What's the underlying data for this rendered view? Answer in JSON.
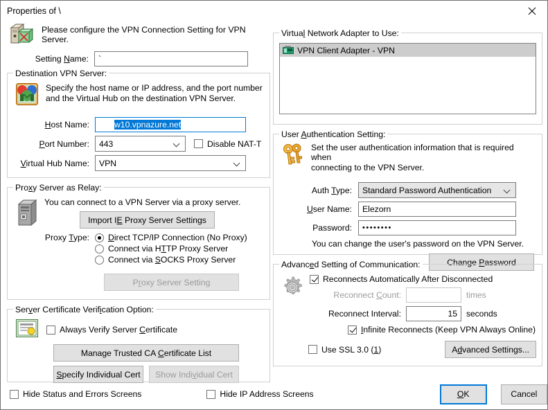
{
  "window": {
    "title": "Properties of \\",
    "close_icon": "close-icon"
  },
  "header": {
    "icon": "vpn-connection-icon",
    "text": "Please configure the VPN Connection Setting for VPN Server."
  },
  "setting_name": {
    "label": "Setting Name:",
    "value": "`",
    "placeholder": ""
  },
  "destination_vpn_server": {
    "legend": "Destination VPN Server:",
    "icon": "binoculars-icon",
    "description_line1": "Specify the host name or IP address, and the port number",
    "description_line2": "and the Virtual Hub on the destination VPN Server.",
    "host_name": {
      "label": "Host Name:",
      "value": "w10.vpnazure.net",
      "selected": true
    },
    "port_number": {
      "label": "Port Number:",
      "value": "443"
    },
    "disable_nat_t": {
      "label": "Disable NAT-T",
      "checked": false
    },
    "virtual_hub_name": {
      "label": "Virtual Hub Name:",
      "value": "VPN"
    }
  },
  "proxy_server_as_relay": {
    "legend": "Proxy Server as Relay:",
    "icon": "computer-tower-icon",
    "description": "You can connect to a VPN Server via a proxy server.",
    "import_button": "Import IE Proxy Server Settings",
    "proxy_type_label": "Proxy Type:",
    "options": [
      {
        "label": "Direct TCP/IP Connection (No Proxy)",
        "selected": true
      },
      {
        "label": "Connect via HTTP Proxy Server",
        "selected": false
      },
      {
        "label": "Connect via SOCKS Proxy Server",
        "selected": false
      }
    ],
    "proxy_setting_button": {
      "label": "Proxy Server Setting",
      "enabled": false
    }
  },
  "server_certificate_verification": {
    "legend": "Server Certificate Verification Option:",
    "icon": "certificate-icon",
    "always_verify": {
      "label": "Always Verify Server Certificate",
      "checked": false
    },
    "manage_ca_button": "Manage Trusted CA Certificate List",
    "specify_cert_button": {
      "label": "Specify Individual Cert",
      "enabled": true
    },
    "show_cert_button": {
      "label": "Show Individual Cert",
      "enabled": false
    }
  },
  "virtual_network_adapter": {
    "legend": "Virtual Network Adapter to Use:",
    "items": [
      {
        "icon": "network-card-icon",
        "label": "VPN Client Adapter - VPN",
        "selected": true
      }
    ]
  },
  "user_authentication": {
    "legend": "User Authentication Setting:",
    "icon": "keys-icon",
    "description_line1": "Set the user authentication information that is required when",
    "description_line2": "connecting to the VPN Server.",
    "auth_type": {
      "label": "Auth Type:",
      "value": "Standard Password Authentication"
    },
    "user_name": {
      "label": "User Name:",
      "value": "Elezorn"
    },
    "password": {
      "label": "Password:",
      "value": "••••••••"
    },
    "note": "You can change the user's password on the VPN Server.",
    "change_password_button": "Change Password"
  },
  "advanced_communication": {
    "legend": "Advanced Setting of Communication:",
    "icon": "gear-icon",
    "reconnect_auto": {
      "label": "Reconnects Automatically After Disconnected",
      "checked": true
    },
    "reconnect_count": {
      "label": "Reconnect Count:",
      "value": "",
      "units": "times",
      "enabled": false
    },
    "reconnect_interval": {
      "label": "Reconnect Interval:",
      "value": "15",
      "units": "seconds",
      "enabled": true
    },
    "infinite_reconnects": {
      "label": "Infinite Reconnects (Keep VPN Always Online)",
      "checked": true
    },
    "use_ssl3": {
      "label": "Use SSL 3.0 (1)",
      "checked": false
    },
    "advanced_settings_button": "Advanced Settings..."
  },
  "footer": {
    "hide_status": {
      "label": "Hide Status and Errors Screens",
      "checked": false
    },
    "hide_ip": {
      "label": "Hide IP Address Screens",
      "checked": false
    },
    "ok_button": "OK",
    "cancel_button": "Cancel"
  },
  "colors": {
    "accent": "#0078d7",
    "dialog_bg": "#ffffff",
    "button_bg": "#e1e1e1",
    "selection_bg": "#0078d7",
    "list_selection_bg": "#cdcdcd"
  }
}
